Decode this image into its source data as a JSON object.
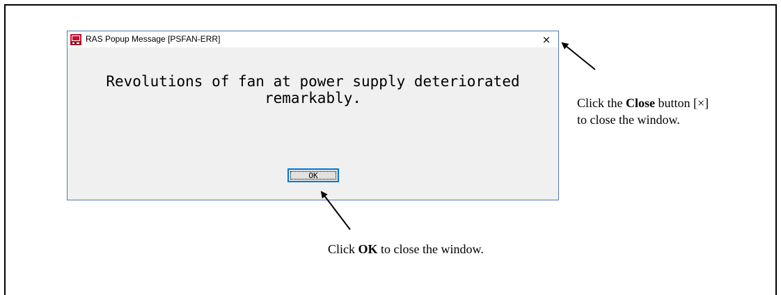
{
  "dialog": {
    "title": "RAS Popup Message [PSFAN-ERR]",
    "close_glyph": "×",
    "message_line1": "Revolutions of fan at power supply deteriorated",
    "message_line2": "remarkably.",
    "ok_label": "OK",
    "app_icon": "ras-app-icon"
  },
  "annotations": {
    "close_prefix": "Click the ",
    "close_bold": "Close",
    "close_mid": " button [×]",
    "close_line2": "to close the window.",
    "ok_prefix": "Click ",
    "ok_bold": "OK",
    "ok_suffix": " to close the window."
  },
  "colors": {
    "dialog_bg": "#f0f0f0",
    "dialog_border": "#4a7ab8",
    "ok_focus_border": "#0078d7",
    "icon_red": "#c8102e"
  }
}
